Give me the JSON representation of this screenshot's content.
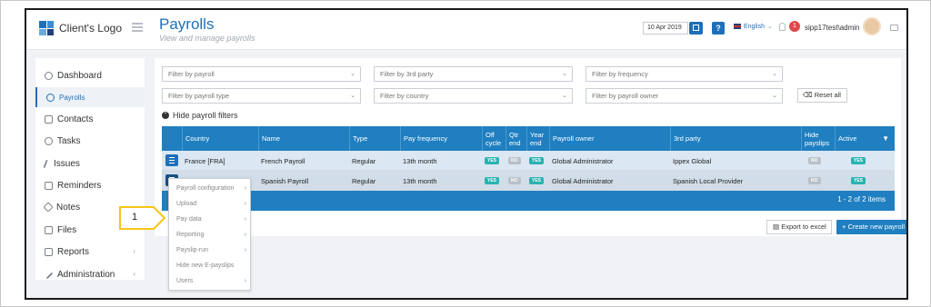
{
  "header": {
    "logo_text": "Client's Logo",
    "title": "Payrolls",
    "subtitle": "View and manage payrolls",
    "date": "10 Apr 2019",
    "help": "?",
    "language": "English",
    "notifications": "1",
    "user": "sipp17test\\admin"
  },
  "sidebar": {
    "items": [
      {
        "label": "Dashboard",
        "icon": "dashboard-icon"
      },
      {
        "label": "Payrolls",
        "icon": "payrolls-icon"
      },
      {
        "label": "Contacts",
        "icon": "contacts-icon"
      },
      {
        "label": "Tasks",
        "icon": "tasks-icon"
      },
      {
        "label": "Issues",
        "icon": "issues-icon"
      },
      {
        "label": "Reminders",
        "icon": "reminders-icon"
      },
      {
        "label": "Notes",
        "icon": "notes-icon"
      },
      {
        "label": "Files",
        "icon": "files-icon"
      },
      {
        "label": "Reports",
        "icon": "reports-icon"
      },
      {
        "label": "Administration",
        "icon": "administration-icon"
      }
    ],
    "chevron": "‹"
  },
  "filters": {
    "payroll": "Filter by payroll",
    "third_party": "Filter by 3rd party",
    "frequency": "Filter by frequency",
    "payroll_type": "Filter by payroll type",
    "country": "Filter by country",
    "payroll_owner": "Filter by payroll owner",
    "reset": "Reset all",
    "hide": "Hide payroll filters"
  },
  "table": {
    "headers": [
      "Country",
      "Name",
      "Type",
      "Pay frequency",
      "Off cycle",
      "Qtr end",
      "Year end",
      "Payroll owner",
      "3rd party",
      "Hide payslips",
      "Active"
    ],
    "rows": [
      {
        "country": "France [FRA]",
        "name": "French Payroll",
        "type": "Regular",
        "frequency": "13th month",
        "off_cycle": "YES",
        "qtr_end": "NO",
        "year_end": "YES",
        "owner": "Global Administrator",
        "third_party": "Ippex Global",
        "hide_payslips": "NO",
        "active": "YES"
      },
      {
        "country": "Spain [ESP]",
        "name": "Spanish Payroll",
        "type": "Regular",
        "frequency": "13th month",
        "off_cycle": "YES",
        "qtr_end": "NO",
        "year_end": "YES",
        "owner": "Global Administrator",
        "third_party": "Spanish Local Provider",
        "hide_payslips": "NO",
        "active": "YES"
      }
    ],
    "footer": "1 - 2 of 2 items"
  },
  "actions": {
    "export": "Export to excel",
    "create": "+ Create new payroll"
  },
  "context_menu": {
    "items": [
      {
        "label": "Payroll configuration",
        "arrow": "›"
      },
      {
        "label": "Upload",
        "arrow": "›"
      },
      {
        "label": "Pay data",
        "arrow": "›"
      },
      {
        "label": "Reporting",
        "arrow": "›"
      },
      {
        "label": "Payslip-run",
        "arrow": "›"
      },
      {
        "label": "Hide new E-payslips",
        "arrow": ""
      },
      {
        "label": "Users",
        "arrow": "›"
      }
    ]
  },
  "callout": {
    "label": "1",
    "color": "#f5c518"
  },
  "colors": {
    "brand": "#1f6fb8",
    "table_header": "#1f7fc0",
    "yes": "#2ab3b0",
    "no": "#b9c0c8"
  }
}
